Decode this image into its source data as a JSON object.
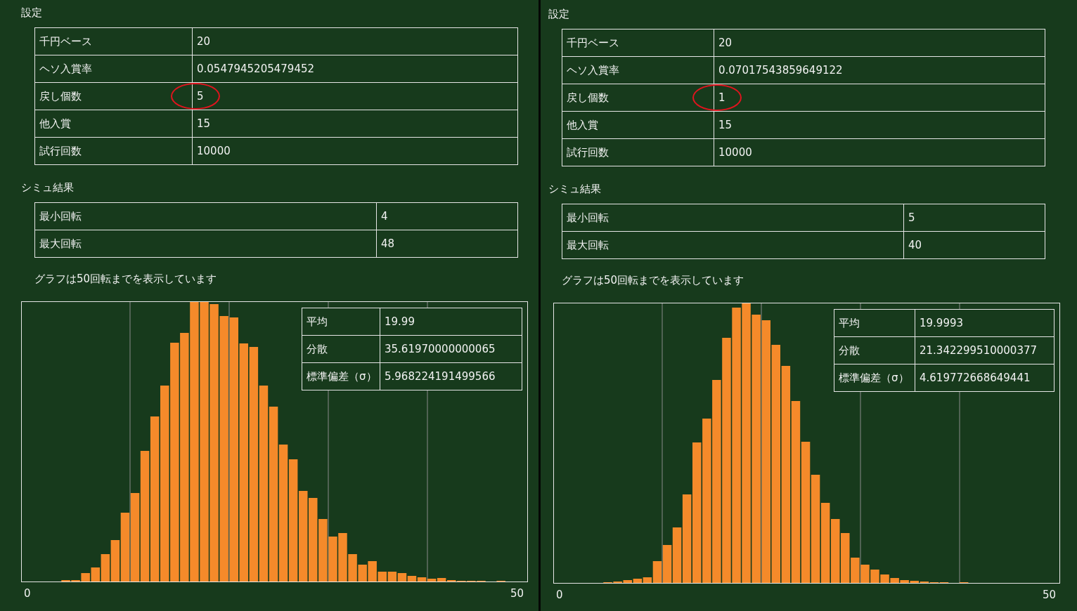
{
  "panels": [
    {
      "settings_title": "設定",
      "settings": [
        {
          "label": "千円ベース",
          "value": "20",
          "circled": false
        },
        {
          "label": "ヘソ入賞率",
          "value": "0.0547945205479452",
          "circled": false
        },
        {
          "label": "戻し個数",
          "value": "5",
          "circled": true
        },
        {
          "label": "他入賞",
          "value": "15",
          "circled": false
        },
        {
          "label": "試行回数",
          "value": "10000",
          "circled": false
        }
      ],
      "results_title": "シミュ結果",
      "results": [
        {
          "label": "最小回転",
          "value": "4"
        },
        {
          "label": "最大回転",
          "value": "48"
        }
      ],
      "caption": "グラフは50回転までを表示しています",
      "stats": [
        {
          "label": "平均",
          "value": "19.99"
        },
        {
          "label": "分散",
          "value": "35.61970000000065"
        },
        {
          "label": "標準偏差（σ）",
          "value": "5.968224191499566"
        }
      ],
      "axis_start": "0",
      "axis_end": "50"
    },
    {
      "settings_title": "設定",
      "settings": [
        {
          "label": "千円ベース",
          "value": "20",
          "circled": false
        },
        {
          "label": "ヘソ入賞率",
          "value": "0.07017543859649122",
          "circled": false
        },
        {
          "label": "戻し個数",
          "value": "1",
          "circled": true
        },
        {
          "label": "他入賞",
          "value": "15",
          "circled": false
        },
        {
          "label": "試行回数",
          "value": "10000",
          "circled": false
        }
      ],
      "results_title": "シミュ結果",
      "results": [
        {
          "label": "最小回転",
          "value": "5"
        },
        {
          "label": "最大回転",
          "value": "40"
        }
      ],
      "caption": "グラフは50回転までを表示しています",
      "stats": [
        {
          "label": "平均",
          "value": "19.9993"
        },
        {
          "label": "分散",
          "value": "21.342299510000377"
        },
        {
          "label": "標準偏差（σ）",
          "value": "4.619772668649441"
        }
      ],
      "axis_start": "0",
      "axis_end": "50"
    }
  ]
}
